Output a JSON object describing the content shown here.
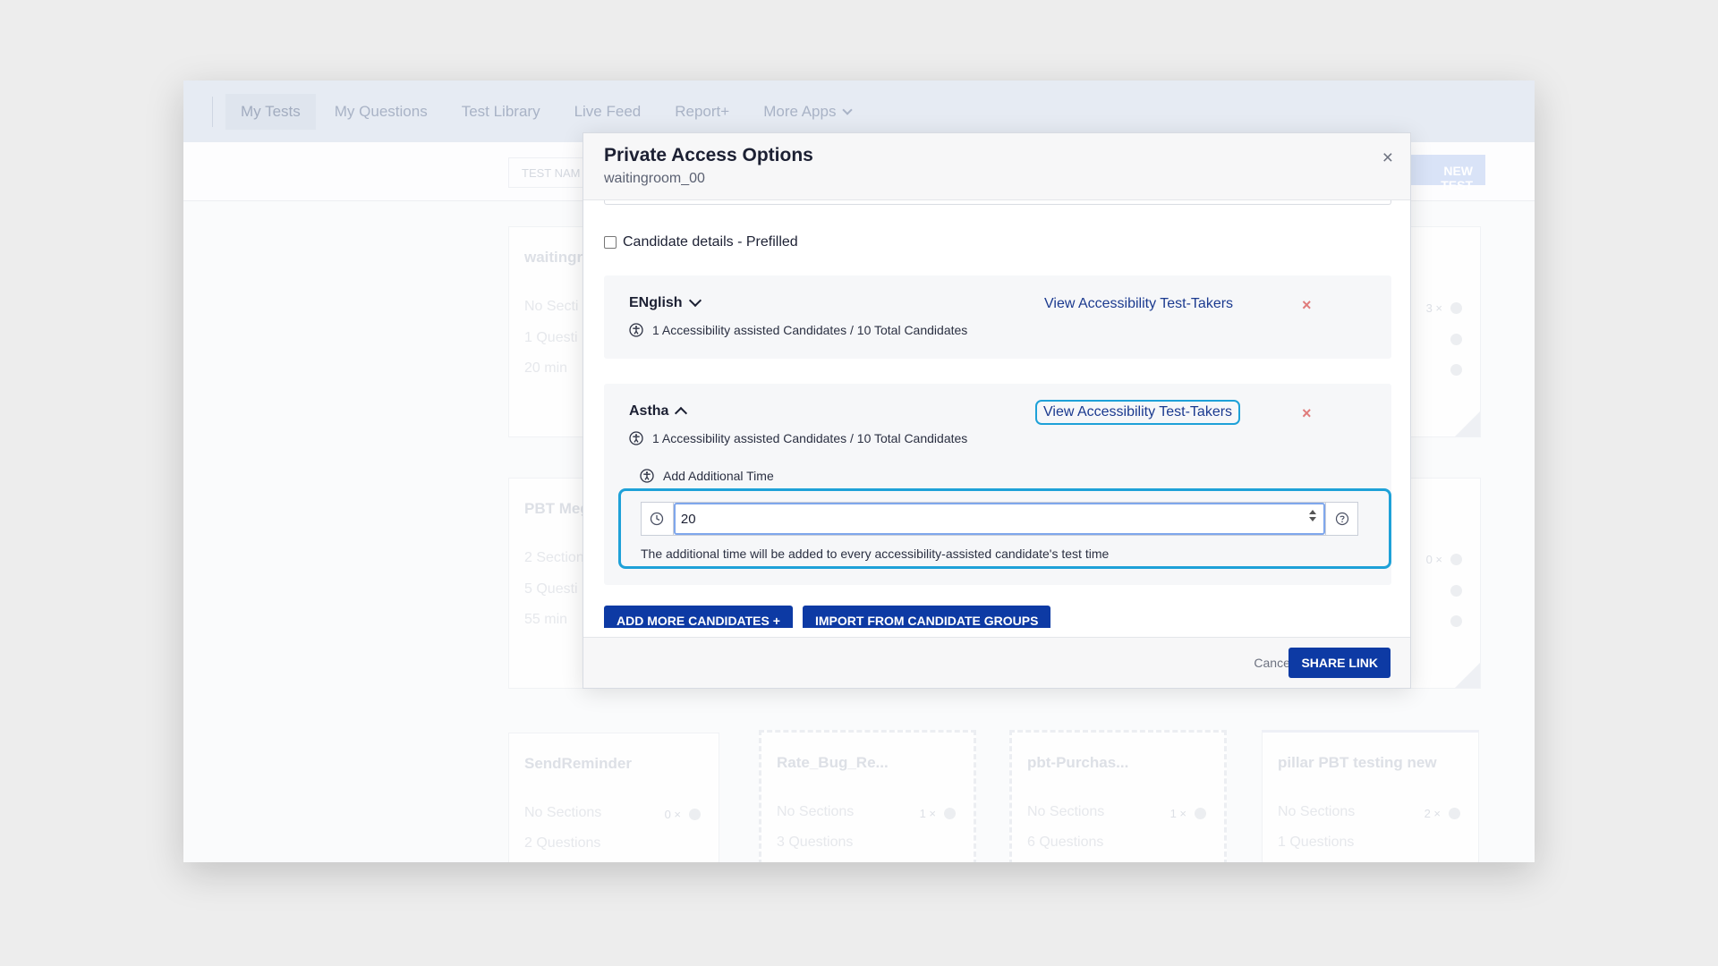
{
  "nav": {
    "items": [
      {
        "label": "My Tests",
        "active": true
      },
      {
        "label": "My Questions"
      },
      {
        "label": "Test Library"
      },
      {
        "label": "Live Feed"
      },
      {
        "label": "Report+"
      },
      {
        "label": "More Apps"
      }
    ]
  },
  "filter": {
    "test_name_placeholder": "TEST NAM",
    "new_test_label": "NEW TEST"
  },
  "background_cards": [
    {
      "title": "waitingr",
      "lines": [
        "No Secti",
        "1 Questi",
        "20 min"
      ],
      "count": "3 ×"
    },
    {
      "title": "PBT Meg",
      "lines": [
        "2 Section",
        "5 Questi",
        "55 min"
      ],
      "count": "0 ×"
    },
    {
      "title": "SendReminder",
      "lines": [
        "No Sections",
        "2 Questions"
      ],
      "count": "0 ×"
    },
    {
      "title": "Rate_Bug_Re...",
      "lines": [
        "No Sections",
        "3 Questions"
      ],
      "count": "1 ×"
    },
    {
      "title": "pbt-Purchas...",
      "lines": [
        "No Sections",
        "6 Questions"
      ],
      "count": "1 ×"
    },
    {
      "title": "pillar PBT testing new",
      "lines": [
        "No Sections",
        "1 Questions"
      ],
      "count": "2 ×"
    }
  ],
  "modal": {
    "title": "Private Access Options",
    "subtitle": "waitingroom_00",
    "close_glyph": "×",
    "prefill_label": "Candidate details - Prefilled",
    "groups": [
      {
        "name": "ENglish",
        "expanded": false,
        "stats": "1 Accessibility assisted Candidates / 10 Total Candidates",
        "view_label": "View Accessibility Test-Takers",
        "remove_glyph": "×"
      },
      {
        "name": "Astha",
        "expanded": true,
        "stats": "1 Accessibility assisted Candidates / 10 Total Candidates",
        "view_label": "View Accessibility Test-Takers",
        "remove_glyph": "×",
        "add_time_label": "Add Additional Time",
        "time_value": "20",
        "time_help": "The additional time will be added to every accessibility-assisted candidate's test time"
      }
    ],
    "add_more_label": "ADD MORE CANDIDATES +",
    "import_label": "IMPORT FROM CANDIDATE GROUPS",
    "cancel_label": "Cancel",
    "share_label": "SHARE LINK"
  },
  "colors": {
    "primary": "#0d3aa4",
    "focus_ring": "#1ea1d8",
    "remove": "#e07c7c",
    "link": "#1b3a8f"
  }
}
